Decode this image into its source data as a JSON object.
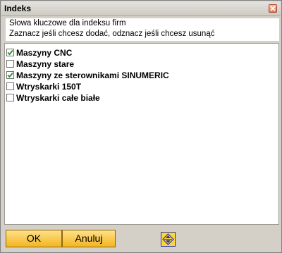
{
  "window": {
    "title": "Indeks"
  },
  "description": {
    "line1": "Słowa kluczowe dla indeksu firm",
    "line2": "Zaznacz jeśli chcesz dodać, odznacz jeśli chcesz usunąć"
  },
  "items": [
    {
      "label": "Maszyny CNC",
      "checked": true
    },
    {
      "label": "Maszyny stare",
      "checked": false
    },
    {
      "label": "Maszyny ze sterownikami SINUMERIC",
      "checked": true
    },
    {
      "label": "Wtryskarki 150T",
      "checked": false
    },
    {
      "label": "Wtryskarki całe białe",
      "checked": false
    }
  ],
  "buttons": {
    "ok": "OK",
    "cancel": "Anuluj"
  },
  "icons": {
    "close": "close-icon",
    "resize": "expand-collapse-icon"
  },
  "colors": {
    "button_fill": "#f3b520",
    "check": "#2a8a2a"
  }
}
